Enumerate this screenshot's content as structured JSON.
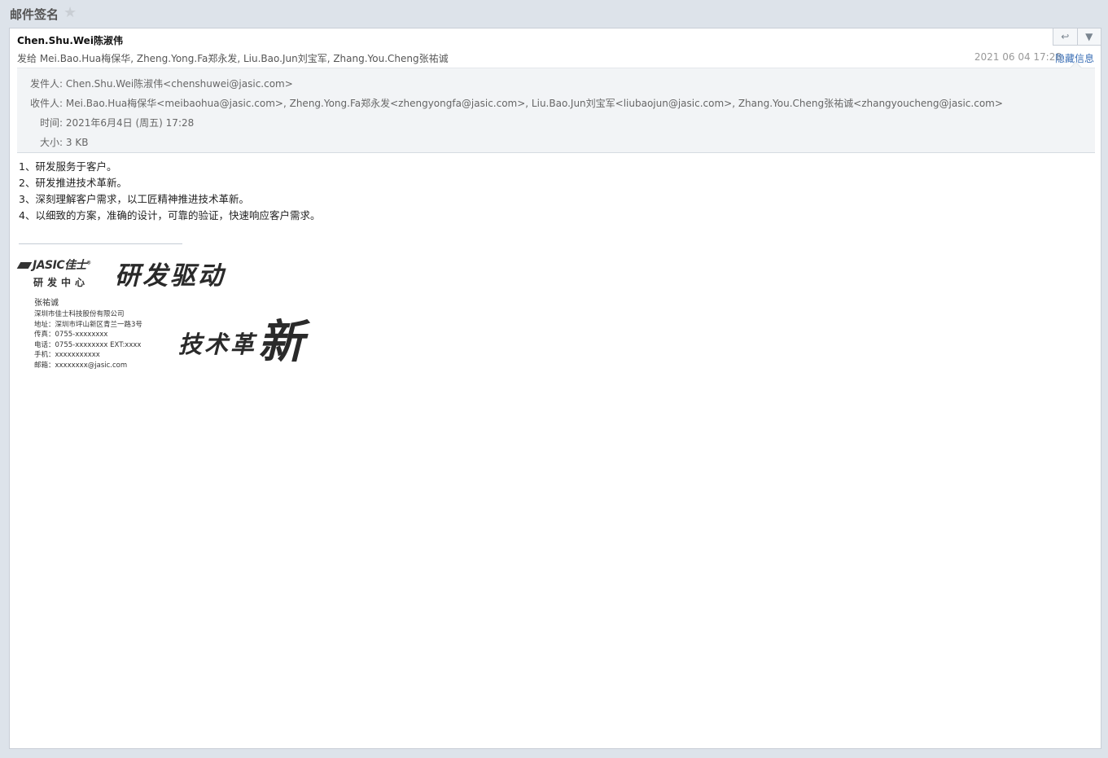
{
  "window": {
    "title": "邮件签名"
  },
  "header": {
    "sender_display": "Chen.Shu.Wei陈淑伟",
    "to_line": "发给 Mei.Bao.Hua梅保华, Zheng.Yong.Fa郑永发, Liu.Bao.Jun刘宝军, Zhang.You.Cheng张祐诚",
    "date": "2021 06 04 17:28",
    "hide_details_label": "隐藏信息",
    "reply_icon": "↩",
    "more_icon": "▼"
  },
  "details": {
    "from_label": "发件人:",
    "from_value": "Chen.Shu.Wei陈淑伟<chenshuwei@jasic.com>",
    "to_label": "收件人:",
    "to_value": "Mei.Bao.Hua梅保华<meibaohua@jasic.com>, Zheng.Yong.Fa郑永发<zhengyongfa@jasic.com>, Liu.Bao.Jun刘宝军<liubaojun@jasic.com>, Zhang.You.Cheng张祐诚<zhangyoucheng@jasic.com>",
    "time_label": "时间:",
    "time_value": "2021年6月4日 (周五) 17:28",
    "size_label": "大小:",
    "size_value": "3 KB"
  },
  "body": {
    "lines": [
      "1、研发服务于客户。",
      "2、研发推进技术革新。",
      "3、深刻理解客户需求，以工匠精神推进技术革新。",
      "4、以细致的方案，准确的设计，可靠的验证，快速响应客户需求。"
    ]
  },
  "signature": {
    "logo_text": "JASIC佳士",
    "logo_tm": "®",
    "dept": "研发中心",
    "slogan_line1": "研发驱动",
    "slogan_line2": "技术革",
    "slogan_last_char": "新",
    "name": "张祐诚",
    "company": "深圳市佳士科技股份有限公司",
    "address": "地址：深圳市坪山新区青兰一路3号",
    "fax": "传真：0755-xxxxxxxx",
    "phone": "电话：0755-xxxxxxxx  EXT:xxxx",
    "mobile": "手机：xxxxxxxxxxx",
    "email": "邮箱：xxxxxxxx@jasic.com"
  },
  "icons": {
    "star": "star-icon",
    "reply": "reply-icon",
    "dropdown": "chevron-down-icon"
  }
}
